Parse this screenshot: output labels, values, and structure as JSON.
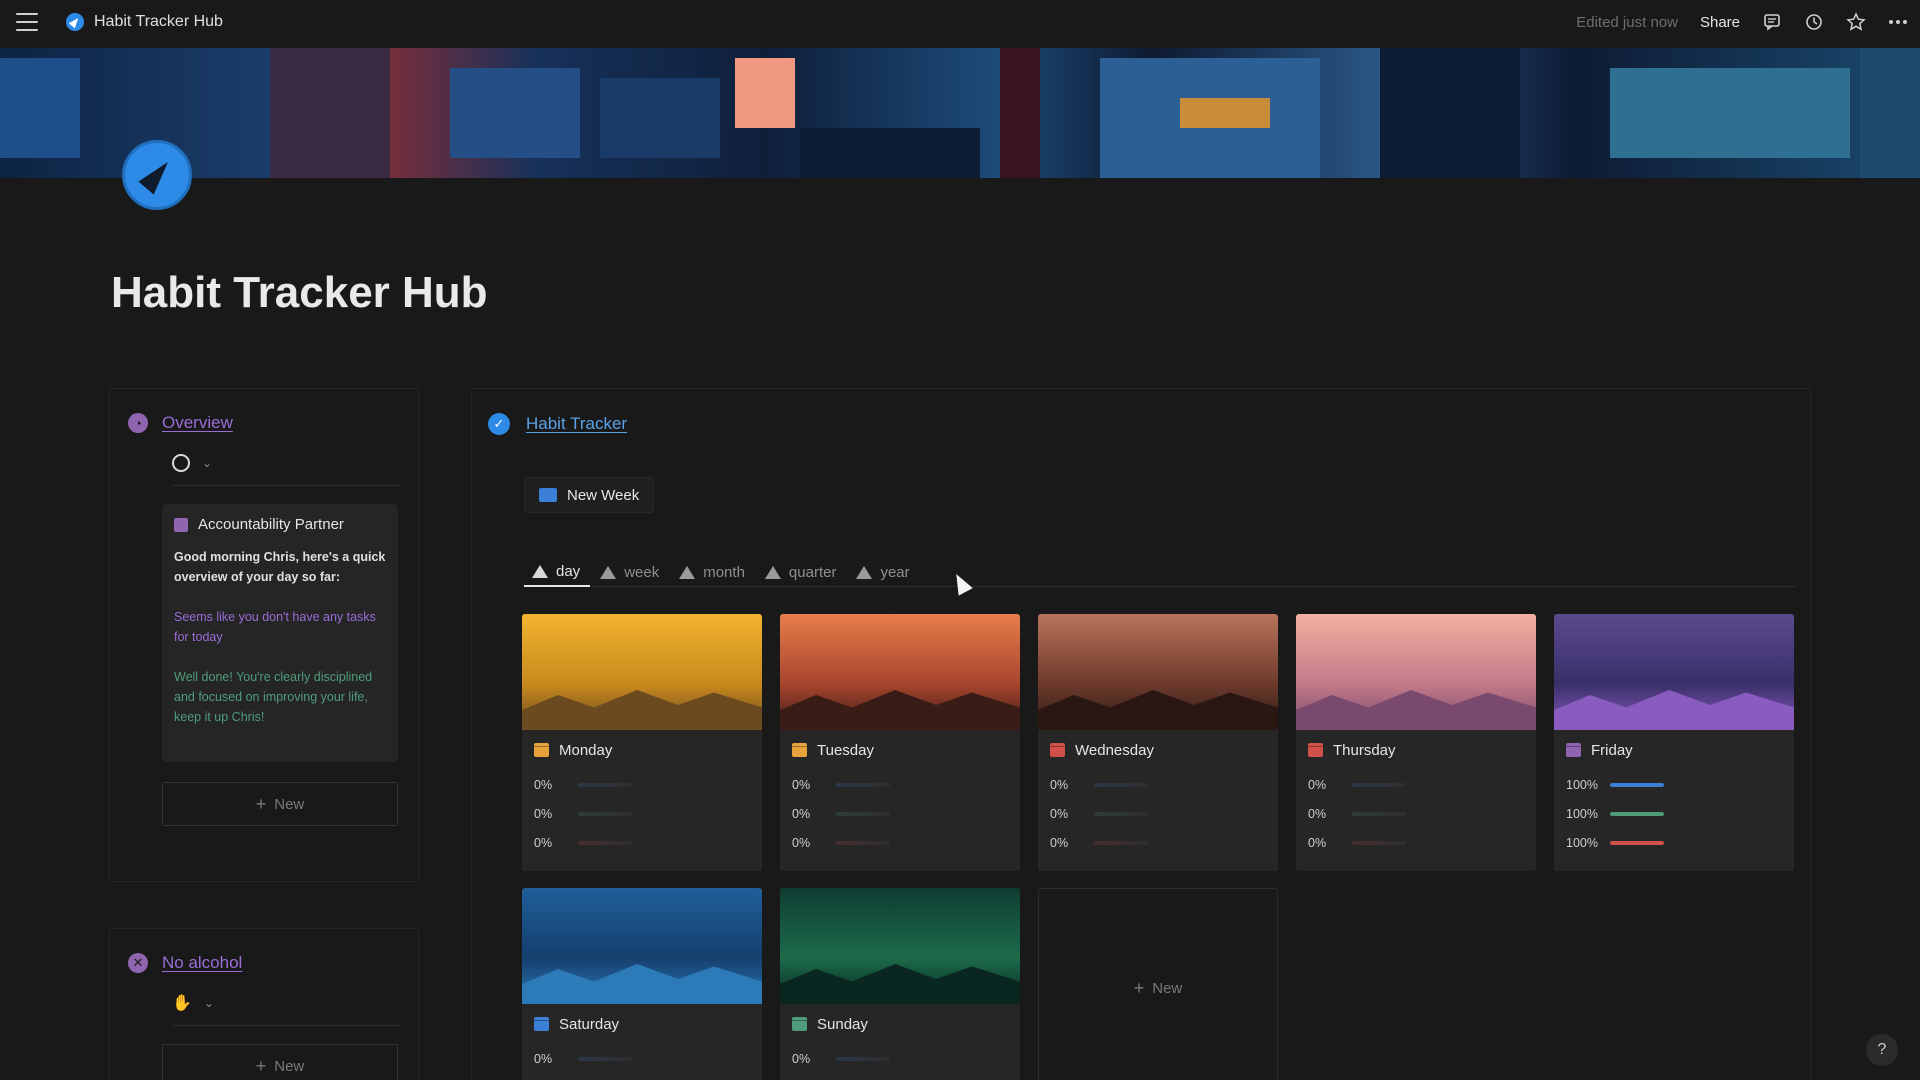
{
  "topbar": {
    "page_name": "Habit Tracker Hub",
    "edited": "Edited just now",
    "share": "Share"
  },
  "page": {
    "title": "Habit Tracker Hub"
  },
  "overview": {
    "title": "Overview",
    "partner": {
      "title": "Accountability Partner",
      "greeting": "Good morning Chris, here's a quick overview of your day so far:",
      "tasks": "Seems like you don't have any tasks for today",
      "praise": "Well done! You're clearly disciplined and focused on improving your life, keep it up Chris!"
    },
    "new_label": "New"
  },
  "no_alcohol": {
    "title": "No alcohol",
    "new_label": "New"
  },
  "habit_tracker": {
    "title": "Habit Tracker",
    "new_week": "New Week",
    "tabs": [
      {
        "label": "day",
        "active": true
      },
      {
        "label": "week",
        "active": false
      },
      {
        "label": "month",
        "active": false
      },
      {
        "label": "quarter",
        "active": false
      },
      {
        "label": "year",
        "active": false
      }
    ],
    "new_tile": "New",
    "days": [
      {
        "name": "Monday",
        "icon_color": "#e8a33c",
        "image": [
          "#f2b430",
          "#c98a1d",
          "#6b4a1f"
        ],
        "progress": [
          {
            "label": "0%",
            "value": 0,
            "color": "#3c7fd6"
          },
          {
            "label": "0%",
            "value": 0,
            "color": "#4f9c7a"
          },
          {
            "label": "0%",
            "value": 0,
            "color": "#d1504a"
          }
        ]
      },
      {
        "name": "Tuesday",
        "icon_color": "#e8a33c",
        "image": [
          "#e87e4a",
          "#a8452e",
          "#3a1c16"
        ],
        "progress": [
          {
            "label": "0%",
            "value": 0,
            "color": "#3c7fd6"
          },
          {
            "label": "0%",
            "value": 0,
            "color": "#4f9c7a"
          },
          {
            "label": "0%",
            "value": 0,
            "color": "#d1504a"
          }
        ]
      },
      {
        "name": "Wednesday",
        "icon_color": "#d1504a",
        "image": [
          "#b9735a",
          "#6e3b2d",
          "#2a1713"
        ],
        "progress": [
          {
            "label": "0%",
            "value": 0,
            "color": "#3c7fd6"
          },
          {
            "label": "0%",
            "value": 0,
            "color": "#4f9c7a"
          },
          {
            "label": "0%",
            "value": 0,
            "color": "#d1504a"
          }
        ]
      },
      {
        "name": "Thursday",
        "icon_color": "#d1504a",
        "image": [
          "#f4b0a0",
          "#c47a8a",
          "#7a4a6e"
        ],
        "progress": [
          {
            "label": "0%",
            "value": 0,
            "color": "#3c7fd6"
          },
          {
            "label": "0%",
            "value": 0,
            "color": "#4f9c7a"
          },
          {
            "label": "0%",
            "value": 0,
            "color": "#d1504a"
          }
        ]
      },
      {
        "name": "Friday",
        "icon_color": "#9065b0",
        "image": [
          "#5a4a8e",
          "#3a2f6a",
          "#8a5cc0"
        ],
        "progress": [
          {
            "label": "100%",
            "value": 100,
            "color": "#3c7fd6"
          },
          {
            "label": "100%",
            "value": 100,
            "color": "#4f9c7a"
          },
          {
            "label": "100%",
            "value": 100,
            "color": "#d1504a"
          }
        ]
      },
      {
        "name": "Saturday",
        "icon_color": "#3c7fd6",
        "image": [
          "#1f5f9a",
          "#153f6e",
          "#2c7ab8"
        ],
        "progress": [
          {
            "label": "0%",
            "value": 0,
            "color": "#3c7fd6"
          }
        ]
      },
      {
        "name": "Sunday",
        "icon_color": "#4f9c7a",
        "image": [
          "#0f3d33",
          "#1c6b4a",
          "#0a2620"
        ],
        "progress": [
          {
            "label": "0%",
            "value": 0,
            "color": "#3c7fd6"
          }
        ]
      }
    ]
  },
  "colors": {
    "accent_purple": "#9a6dd7",
    "accent_blue": "#5aa2e6",
    "background": "#191919"
  }
}
